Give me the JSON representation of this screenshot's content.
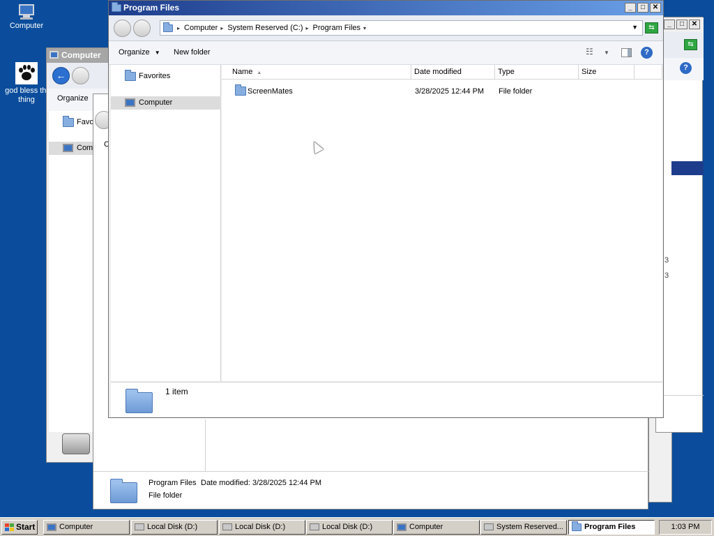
{
  "desktop": {
    "icons": [
      {
        "label": "Computer",
        "icon": "computer-icon"
      },
      {
        "label_line1": "god bless thi",
        "label_line2": "thing",
        "icon": "paw-icon"
      }
    ]
  },
  "back_windows": {
    "left_title": "Computer",
    "left_toolbar_organize": "Organize",
    "left_nav_favorites": "Favo",
    "left_nav_computer": "Com",
    "mid_addr_fragment": "C",
    "mid_details_name": "Program Files",
    "mid_details_date": "Date modified: 3/28/2025 12:44 PM",
    "mid_details_type": "File folder",
    "right_fragment_1": "3",
    "right_fragment_2": "3"
  },
  "window": {
    "title": "Program Files",
    "buttons": {
      "minimize": "_",
      "maximize": "□",
      "close": "✕"
    },
    "breadcrumb": [
      "Computer",
      "System Reserved (C:)",
      "Program Files"
    ],
    "toolbar": {
      "organize": "Organize",
      "new_folder": "New folder",
      "help": "?"
    },
    "nav": {
      "favorites": "Favorites",
      "computer": "Computer"
    },
    "columns": [
      "Name",
      "Date modified",
      "Type",
      "Size"
    ],
    "files": [
      {
        "name": "ScreenMates",
        "date_modified": "3/28/2025 12:44 PM",
        "type": "File folder",
        "size": ""
      }
    ],
    "status": {
      "count": "1 item"
    }
  },
  "taskbar": {
    "start_label": "Start",
    "buttons": [
      {
        "label": "Computer",
        "active": false
      },
      {
        "label": "Local Disk (D:)",
        "active": false
      },
      {
        "label": "Local Disk (D:)",
        "active": false
      },
      {
        "label": "Local Disk (D:)",
        "active": false
      },
      {
        "label": "Computer",
        "active": false
      },
      {
        "label": "System Reserved...",
        "active": false
      },
      {
        "label": "Program Files",
        "active": true
      }
    ],
    "clock": "1:03 PM"
  },
  "colors": {
    "desktop": "#0b4d9c",
    "title_active_start": "#1d3d8c",
    "title_active_end": "#6aa0e8",
    "title_inactive": "#a6a6a6",
    "refresh_green": "#2fa642"
  }
}
